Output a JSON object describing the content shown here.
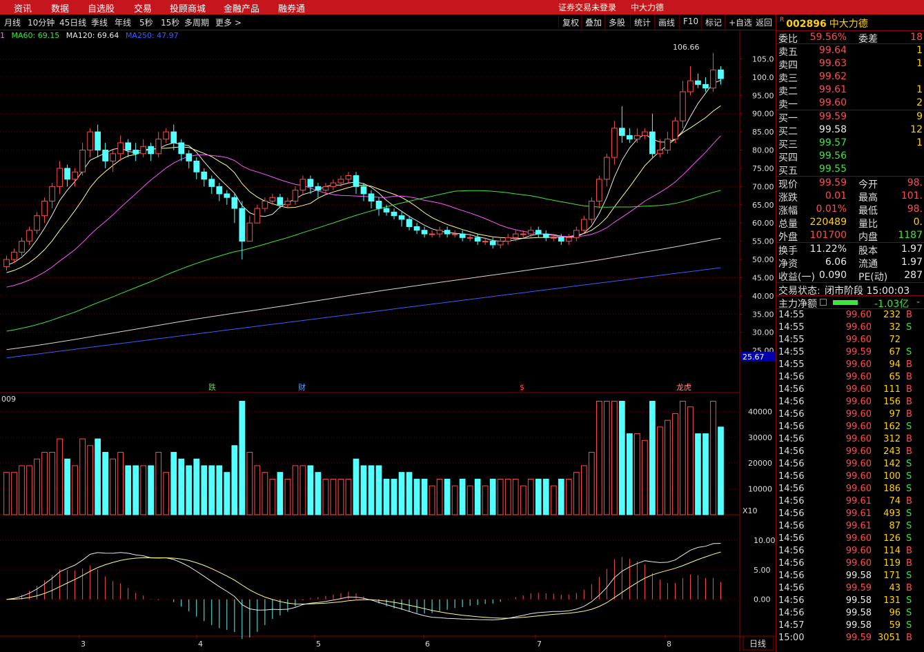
{
  "menu": {
    "items": [
      "资讯",
      "数据",
      "自选股",
      "交易",
      "投顾商城",
      "金融产品",
      "融券通"
    ],
    "login_text": "证券交易未登录",
    "stock_name": "中大力德"
  },
  "toolbar": {
    "periods": [
      "月线",
      "10分钟",
      "45日线",
      "季线",
      "年线",
      "5秒",
      "15秒",
      "多周期",
      "更多 >"
    ],
    "buttons": [
      "复权",
      "叠加",
      "多股",
      "统计",
      "画线",
      "F10",
      "标记",
      "+自选",
      "返回"
    ]
  },
  "ma_legend": {
    "prefix": "1",
    "ma60": "MA60: 69.15",
    "ma120": "MA120: 69.64",
    "ma250": "MA250: 47.97"
  },
  "price_chart": {
    "high_label": "106.66",
    "current_marker": "25.67",
    "event_labels": [
      "跌",
      "财",
      "$",
      "龙虎"
    ],
    "y_ticks": [
      "105.0",
      "100.0",
      "95.00",
      "90.00",
      "85.00",
      "80.00",
      "75.00",
      "70.00",
      "65.00",
      "60.00",
      "55.00",
      "50.00",
      "45.00",
      "40.00",
      "35.00",
      "30.00",
      "25.00"
    ],
    "ylim": [
      22,
      110
    ]
  },
  "volume_chart": {
    "label": "009",
    "y_ticks": [
      "40000",
      "30000",
      "20000",
      "10000"
    ],
    "unit": "X10"
  },
  "macd_chart": {
    "y_ticks": [
      "10.00",
      "5.00",
      "0.00"
    ]
  },
  "x_axis": {
    "months": [
      "3",
      "4",
      "5",
      "6",
      "7",
      "8"
    ],
    "period_button": "日线"
  },
  "chart_data": {
    "type": "candlestick",
    "series_candles": [
      [
        48,
        50,
        47,
        51
      ],
      [
        50,
        52,
        49,
        53
      ],
      [
        52,
        55,
        51,
        56
      ],
      [
        55,
        58,
        54,
        59
      ],
      [
        58,
        62,
        57,
        63
      ],
      [
        62,
        66,
        60,
        67
      ],
      [
        66,
        70,
        64,
        71
      ],
      [
        70,
        75,
        68,
        77
      ],
      [
        75,
        72,
        70,
        76
      ],
      [
        72,
        74,
        70,
        75
      ],
      [
        74,
        80,
        73,
        82
      ],
      [
        80,
        85,
        78,
        86
      ],
      [
        85,
        80,
        78,
        87
      ],
      [
        80,
        77,
        75,
        82
      ],
      [
        77,
        79,
        74,
        80
      ],
      [
        79,
        82,
        77,
        84
      ],
      [
        82,
        80,
        78,
        83
      ],
      [
        80,
        79,
        77,
        82
      ],
      [
        79,
        81,
        78,
        83
      ],
      [
        81,
        79,
        77,
        82
      ],
      [
        79,
        83,
        78,
        85
      ],
      [
        83,
        85,
        82,
        86
      ],
      [
        85,
        82,
        80,
        87
      ],
      [
        82,
        79,
        77,
        83
      ],
      [
        79,
        77,
        75,
        80
      ],
      [
        77,
        74,
        72,
        78
      ],
      [
        74,
        72,
        70,
        75
      ],
      [
        72,
        70,
        68,
        73
      ],
      [
        70,
        68,
        66,
        71
      ],
      [
        68,
        67,
        65,
        69
      ],
      [
        67,
        64,
        60,
        68
      ],
      [
        64,
        55,
        50,
        66
      ],
      [
        55,
        60,
        55,
        62
      ],
      [
        60,
        64,
        60,
        65
      ],
      [
        64,
        66,
        63,
        67
      ],
      [
        66,
        67,
        65,
        68
      ],
      [
        67,
        65,
        64,
        68
      ],
      [
        65,
        66,
        64,
        67
      ],
      [
        66,
        69,
        65,
        70
      ],
      [
        69,
        72,
        68,
        73
      ],
      [
        72,
        70,
        68,
        73
      ],
      [
        70,
        69,
        67,
        71
      ],
      [
        69,
        70,
        68,
        71
      ],
      [
        70,
        71,
        69,
        72
      ],
      [
        71,
        72,
        70,
        73
      ],
      [
        72,
        73,
        71,
        74
      ],
      [
        73,
        70,
        68,
        74
      ],
      [
        70,
        68,
        66,
        71
      ],
      [
        68,
        66,
        64,
        69
      ],
      [
        66,
        64,
        62,
        67
      ],
      [
        64,
        63,
        62,
        65
      ],
      [
        63,
        62,
        61,
        64
      ],
      [
        62,
        61,
        59,
        63
      ],
      [
        61,
        59,
        58,
        62
      ],
      [
        59,
        58,
        57,
        60
      ],
      [
        58,
        57,
        56,
        59
      ],
      [
        57,
        57,
        56,
        58
      ],
      [
        57,
        58,
        56,
        59
      ],
      [
        58,
        57,
        56,
        59
      ],
      [
        57,
        57,
        56,
        58
      ],
      [
        57,
        56,
        55,
        58
      ],
      [
        56,
        56,
        55,
        57
      ],
      [
        56,
        55,
        54,
        57
      ],
      [
        55,
        55,
        54,
        56
      ],
      [
        55,
        54,
        53,
        56
      ],
      [
        54,
        55,
        53,
        56
      ],
      [
        55,
        56,
        54,
        57
      ],
      [
        56,
        57,
        55,
        58
      ],
      [
        57,
        57,
        56,
        58
      ],
      [
        57,
        58,
        56,
        59
      ],
      [
        58,
        57,
        56,
        59
      ],
      [
        57,
        56,
        55,
        58
      ],
      [
        56,
        56,
        55,
        57
      ],
      [
        56,
        55,
        54,
        57
      ],
      [
        55,
        56,
        54,
        57
      ],
      [
        56,
        58,
        55,
        59
      ],
      [
        58,
        61,
        57,
        62
      ],
      [
        61,
        66,
        60,
        67
      ],
      [
        66,
        72,
        64,
        73
      ],
      [
        72,
        78,
        70,
        79
      ],
      [
        78,
        86,
        76,
        88
      ],
      [
        86,
        84,
        82,
        92
      ],
      [
        84,
        83,
        82,
        86
      ],
      [
        83,
        84,
        82,
        86
      ],
      [
        84,
        85,
        83,
        86
      ],
      [
        85,
        79,
        78,
        90
      ],
      [
        79,
        80,
        78,
        83
      ],
      [
        80,
        83,
        79,
        85
      ],
      [
        83,
        88,
        82,
        89
      ],
      [
        88,
        96,
        86,
        99
      ],
      [
        96,
        99,
        95,
        103
      ],
      [
        99,
        98,
        97,
        101
      ],
      [
        98,
        97,
        96,
        100
      ],
      [
        97,
        102,
        96,
        106.66
      ],
      [
        102,
        99.59,
        98,
        103
      ]
    ]
  },
  "quote": {
    "code": "002896",
    "name": "中大力德",
    "tag": "R",
    "weibi_label": "委比",
    "weibi_value": "59.56%",
    "weicha_label": "委差",
    "weicha_value": "18",
    "asks": [
      {
        "label": "卖五",
        "price": "99.64",
        "qty": "1"
      },
      {
        "label": "卖四",
        "price": "99.63",
        "qty": "1"
      },
      {
        "label": "卖三",
        "price": "99.62",
        "qty": ""
      },
      {
        "label": "卖二",
        "price": "99.61",
        "qty": "1"
      },
      {
        "label": "卖一",
        "price": "99.60",
        "qty": "2"
      }
    ],
    "bids": [
      {
        "label": "买一",
        "price": "99.59",
        "qty": "9"
      },
      {
        "label": "买二",
        "price": "99.58",
        "qty": "12"
      },
      {
        "label": "买三",
        "price": "99.57",
        "qty": "1"
      },
      {
        "label": "买四",
        "price": "99.56",
        "qty": ""
      },
      {
        "label": "买五",
        "price": "99.55",
        "qty": ""
      }
    ],
    "stats": [
      {
        "l": "现价",
        "v": "99.59",
        "vc": "red",
        "l2": "今开",
        "v2": "98.",
        "v2c": "red"
      },
      {
        "l": "涨跌",
        "v": "0.01",
        "vc": "red",
        "l2": "最高",
        "v2": "101.",
        "v2c": "red"
      },
      {
        "l": "涨幅",
        "v": "0.01%",
        "vc": "red",
        "l2": "最低",
        "v2": "98.",
        "v2c": "red"
      },
      {
        "l": "总量",
        "v": "220489",
        "vc": "yel",
        "l2": "量比",
        "v2": "0.",
        "v2c": "yel"
      },
      {
        "l": "外盘",
        "v": "101700",
        "vc": "red",
        "l2": "内盘",
        "v2": "1187",
        "v2c": "grn"
      }
    ],
    "stats2": [
      {
        "l": "换手",
        "v": "11.22%",
        "vc": "wht",
        "l2": "股本",
        "v2": "1.97",
        "v2c": "wht"
      },
      {
        "l": "净资",
        "v": "6.06",
        "vc": "wht",
        "l2": "流通",
        "v2": "1.97",
        "v2c": "wht"
      },
      {
        "l": "收益(一)",
        "v": "0.090",
        "vc": "wht",
        "l2": "PE(动)",
        "v2": "287",
        "v2c": "wht"
      }
    ],
    "trade_status_label": "交易状态:",
    "trade_status": "闭市阶段 15:00:03",
    "main_flow_label": "主力净额",
    "main_flow_value": "-1.03亿",
    "main_flow_tail": "-"
  },
  "ticks": [
    {
      "t": "14:55",
      "p": "99.60",
      "pc": "red",
      "v": "232",
      "bs": "B"
    },
    {
      "t": "14:55",
      "p": "99.60",
      "pc": "red",
      "v": "32",
      "bs": "S"
    },
    {
      "t": "14:55",
      "p": "99.60",
      "pc": "red",
      "v": "72",
      "bs": ""
    },
    {
      "t": "14:55",
      "p": "99.59",
      "pc": "red",
      "v": "67",
      "bs": "S"
    },
    {
      "t": "14:55",
      "p": "99.60",
      "pc": "red",
      "v": "94",
      "bs": "B"
    },
    {
      "t": "14:56",
      "p": "99.60",
      "pc": "red",
      "v": "65",
      "bs": "B"
    },
    {
      "t": "14:56",
      "p": "99.60",
      "pc": "red",
      "v": "111",
      "bs": "B"
    },
    {
      "t": "14:56",
      "p": "99.60",
      "pc": "red",
      "v": "156",
      "bs": "B"
    },
    {
      "t": "14:56",
      "p": "99.60",
      "pc": "red",
      "v": "97",
      "bs": "B"
    },
    {
      "t": "14:56",
      "p": "99.60",
      "pc": "red",
      "v": "162",
      "bs": "S"
    },
    {
      "t": "14:56",
      "p": "99.60",
      "pc": "red",
      "v": "312",
      "bs": "B"
    },
    {
      "t": "14:56",
      "p": "99.60",
      "pc": "red",
      "v": "243",
      "bs": "B"
    },
    {
      "t": "14:56",
      "p": "99.60",
      "pc": "red",
      "v": "142",
      "bs": "S"
    },
    {
      "t": "14:56",
      "p": "99.60",
      "pc": "red",
      "v": "100",
      "bs": "S"
    },
    {
      "t": "14:56",
      "p": "99.60",
      "pc": "red",
      "v": "186",
      "bs": "S"
    },
    {
      "t": "14:56",
      "p": "99.61",
      "pc": "red",
      "v": "74",
      "bs": "B"
    },
    {
      "t": "14:56",
      "p": "99.61",
      "pc": "red",
      "v": "493",
      "bs": "S"
    },
    {
      "t": "14:56",
      "p": "99.61",
      "pc": "red",
      "v": "87",
      "bs": "S"
    },
    {
      "t": "14:56",
      "p": "99.60",
      "pc": "red",
      "v": "126",
      "bs": "S"
    },
    {
      "t": "14:56",
      "p": "99.60",
      "pc": "red",
      "v": "114",
      "bs": "B"
    },
    {
      "t": "14:56",
      "p": "99.60",
      "pc": "red",
      "v": "119",
      "bs": "B"
    },
    {
      "t": "14:56",
      "p": "99.58",
      "pc": "wht",
      "v": "171",
      "bs": "S"
    },
    {
      "t": "14:56",
      "p": "99.59",
      "pc": "red",
      "v": "43",
      "bs": "B"
    },
    {
      "t": "14:56",
      "p": "99.58",
      "pc": "wht",
      "v": "131",
      "bs": "S"
    },
    {
      "t": "14:56",
      "p": "99.58",
      "pc": "wht",
      "v": "96",
      "bs": "S"
    },
    {
      "t": "14:57",
      "p": "99.58",
      "pc": "wht",
      "v": "59",
      "bs": "S"
    },
    {
      "t": "15:00",
      "p": "99.59",
      "pc": "red",
      "v": "3051",
      "bs": "B"
    }
  ]
}
